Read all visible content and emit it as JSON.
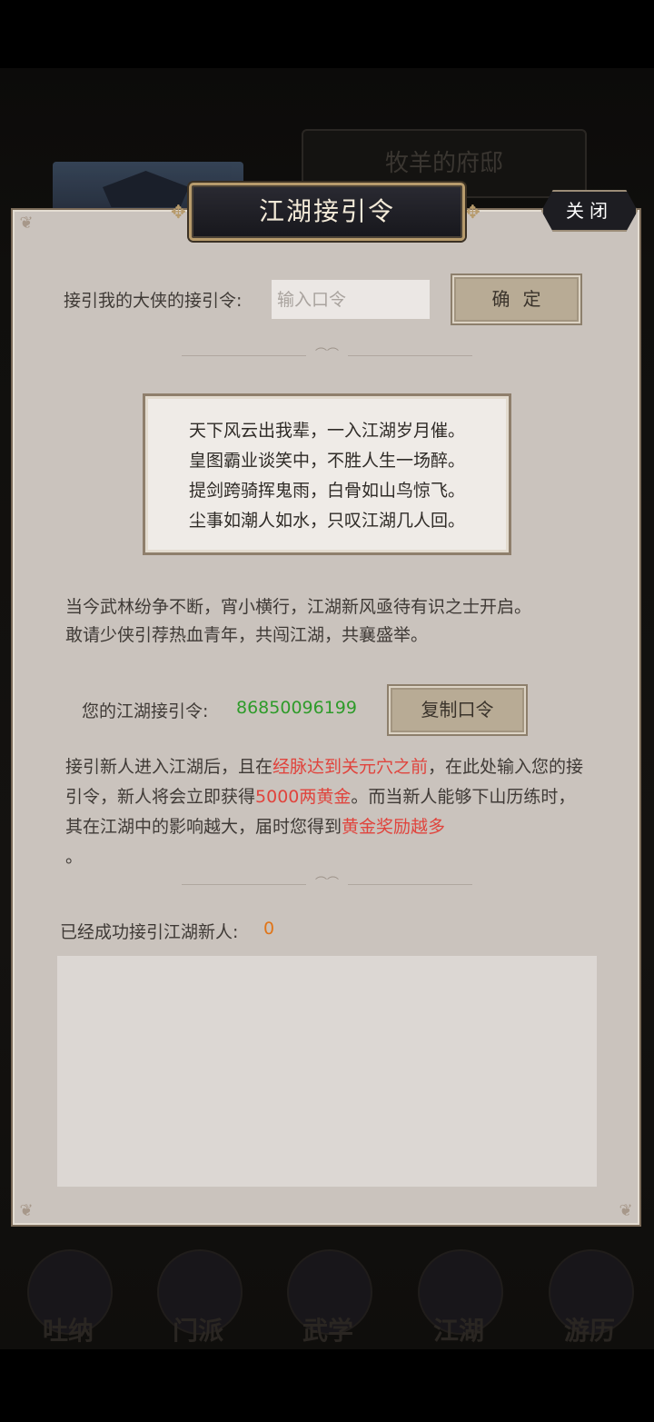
{
  "background": {
    "mansion_title": "牧羊的府邸",
    "nav": [
      {
        "label": "吐纳",
        "icon": "breathing-icon"
      },
      {
        "label": "门派",
        "icon": "sect-icon"
      },
      {
        "label": "武学",
        "icon": "martial-arts-icon"
      },
      {
        "label": "江湖",
        "icon": "jianghu-icon"
      },
      {
        "label": "游历",
        "icon": "travel-icon"
      }
    ]
  },
  "dialog": {
    "title": "江湖接引令",
    "close_label": "关闭"
  },
  "invite_input": {
    "label": "接引我的大侠的接引令:",
    "placeholder": "输入口令",
    "value": "",
    "confirm_label": "确定"
  },
  "poem": {
    "lines": [
      "天下风云出我辈，一入江湖岁月催。",
      "皇图霸业谈笑中，不胜人生一场醉。",
      "提剑跨骑挥鬼雨，白骨如山鸟惊飞。",
      "尘事如潮人如水，只叹江湖几人回。"
    ]
  },
  "intro": {
    "line1": "当今武林纷争不断，宵小横行，江湖新风亟待有识之士开启。",
    "line2": "敢请少侠引荐热血青年，共闯江湖，共襄盛举。"
  },
  "my_code": {
    "label": "您的江湖接引令:",
    "value": "86850096199",
    "copy_label": "复制口令"
  },
  "description": {
    "p1": "接引新人进入江湖后，且在",
    "h1": "经脉达到关元穴之前",
    "p2": "，在此处输入您的接引令，新人将会立即获得",
    "h2": "5000两黄金",
    "p3": "。而当新人能够下山历练时，其在江湖中的影响越大，届时您得到",
    "h3": "黄金奖励越多",
    "p4": "。"
  },
  "invited": {
    "label": "已经成功接引江湖新人:",
    "count": "0"
  },
  "colors": {
    "panel_bg": "#cac3bd",
    "code_green": "#2e9b2a",
    "highlight_red": "#e0443d",
    "count_orange": "#e07417",
    "button_bg": "#b8ab95"
  }
}
